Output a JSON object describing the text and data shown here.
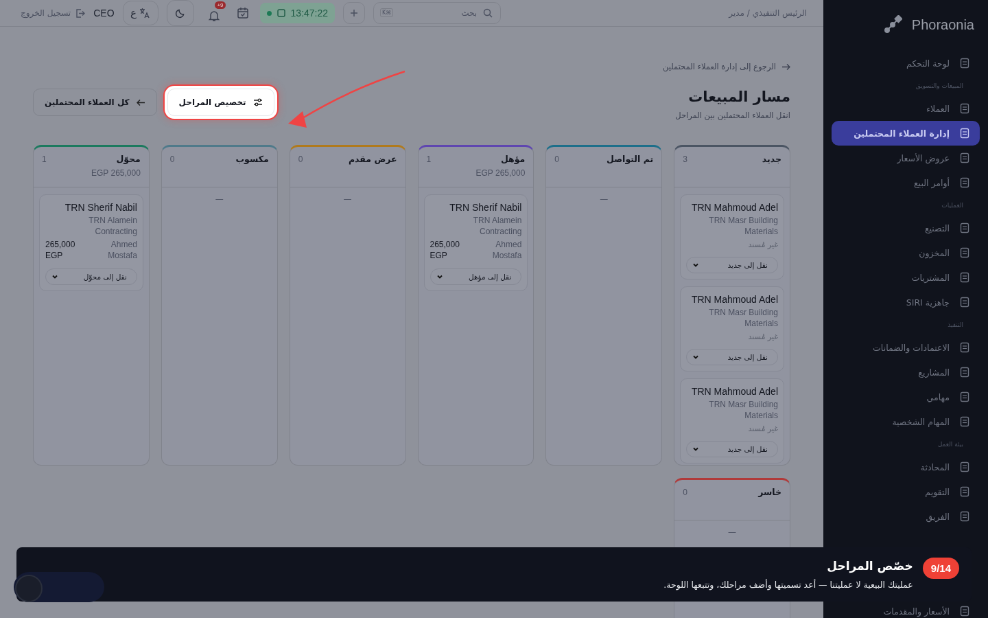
{
  "sidebar": {
    "brand": "Phoraonia",
    "sections": [
      {
        "items": [
          {
            "label": "لوحة التحكم",
            "selected": false
          }
        ]
      },
      {
        "title": "المبيعات والتسويق",
        "items": [
          {
            "label": "العملاء",
            "selected": false
          },
          {
            "label": "إدارة العملاء المحتملين",
            "selected": true
          },
          {
            "label": "عروض الأسعار",
            "selected": false
          },
          {
            "label": "أوامر البيع",
            "selected": false
          }
        ]
      },
      {
        "title": "العمليات",
        "items": [
          {
            "label": "التصنيع",
            "selected": false
          },
          {
            "label": "المخزون",
            "selected": false
          },
          {
            "label": "المشتريات",
            "selected": false
          },
          {
            "label": "جاهزية SIRI",
            "selected": false
          }
        ]
      },
      {
        "title": "التنفيذ",
        "items": [
          {
            "label": "الاعتمادات والضمانات",
            "selected": false
          },
          {
            "label": "المشاريع",
            "selected": false
          },
          {
            "label": "مهامي",
            "selected": false
          },
          {
            "label": "المهام الشخصية",
            "selected": false
          }
        ]
      },
      {
        "title": "بيئة العمل",
        "items": [
          {
            "label": "المحادثة",
            "selected": false
          },
          {
            "label": "التقويم",
            "selected": false
          },
          {
            "label": "الفريق",
            "selected": false
          }
        ]
      },
      {
        "items": [
          {
            "label": "الأسعار والمقدمات",
            "selected": false
          }
        ]
      }
    ]
  },
  "topbar": {
    "breadcrumb": "الرئيس التنفيذي / مدير",
    "search": {
      "placeholder": "بحث",
      "shortcut": "K⌘"
    },
    "clock": "13:47:22",
    "notifications": "+9",
    "language": "ع",
    "role": "CEO",
    "logout": "تسجيل الخروج"
  },
  "header": {
    "back_link": "الرجوع إلى إدارة العملاء المحتملين",
    "title": "مسار المبيعات",
    "subtitle": "انقل العملاء المحتملين بين المراحل",
    "buttons": [
      {
        "label": "تخصيص المراحل",
        "kind": "customize",
        "highlighted": true
      },
      {
        "label": "كل العملاء المحتملين",
        "kind": "back",
        "highlighted": false
      }
    ]
  },
  "columns": [
    {
      "title": "جديد",
      "count": "3",
      "color": "#4b5563",
      "cards": [
        {
          "name": "TRN Mahmoud Adel",
          "company": "TRN Masr Building Materials",
          "assignee": "غير مُسند",
          "move": "نقل إلى جديد"
        },
        {
          "name": "TRN Mahmoud Adel",
          "company": "TRN Masr Building Materials",
          "assignee": "غير مُسند",
          "move": "نقل إلى جديد"
        },
        {
          "name": "TRN Mahmoud Adel",
          "company": "TRN Masr Building Materials",
          "assignee": "غير مُسند",
          "move": "نقل إلى جديد"
        }
      ]
    },
    {
      "title": "تم التواصل",
      "count": "0",
      "color": "#1d6f8a",
      "empty": "—"
    },
    {
      "title": "مؤهل",
      "count": "1",
      "color": "#5f46b0",
      "total": "EGP 265,000",
      "cards": [
        {
          "name": "TRN Sherif Nabil",
          "company": "TRN Alamein Contracting",
          "owner": "Ahmed Mostafa",
          "amount": "265,000 EGP",
          "move": "نقل إلى مؤهل"
        }
      ]
    },
    {
      "title": "عرض مقدم",
      "count": "0",
      "color": "#b07a1c",
      "empty": "—"
    },
    {
      "title": "مكسوب",
      "count": "0",
      "color": "#4f7a8a",
      "empty": "—"
    },
    {
      "title": "محوّل",
      "count": "1",
      "color": "#1c7a5e",
      "total": "EGP 265,000",
      "cards": [
        {
          "name": "TRN Sherif Nabil",
          "company": "TRN Alamein Contracting",
          "owner": "Ahmed Mostafa",
          "amount": "265,000 EGP",
          "move": "نقل إلى محوّل"
        }
      ]
    },
    {
      "title": "خاسر",
      "count": "0",
      "color": "#b03a3a",
      "empty": "—"
    }
  ],
  "tour": {
    "step": "9/14",
    "title": "خصّص المراحل",
    "body": "عمليتك البيعية لا عمليتنا — أعد تسميتها وأضف مراحلك، وتتبعها اللوحة."
  }
}
